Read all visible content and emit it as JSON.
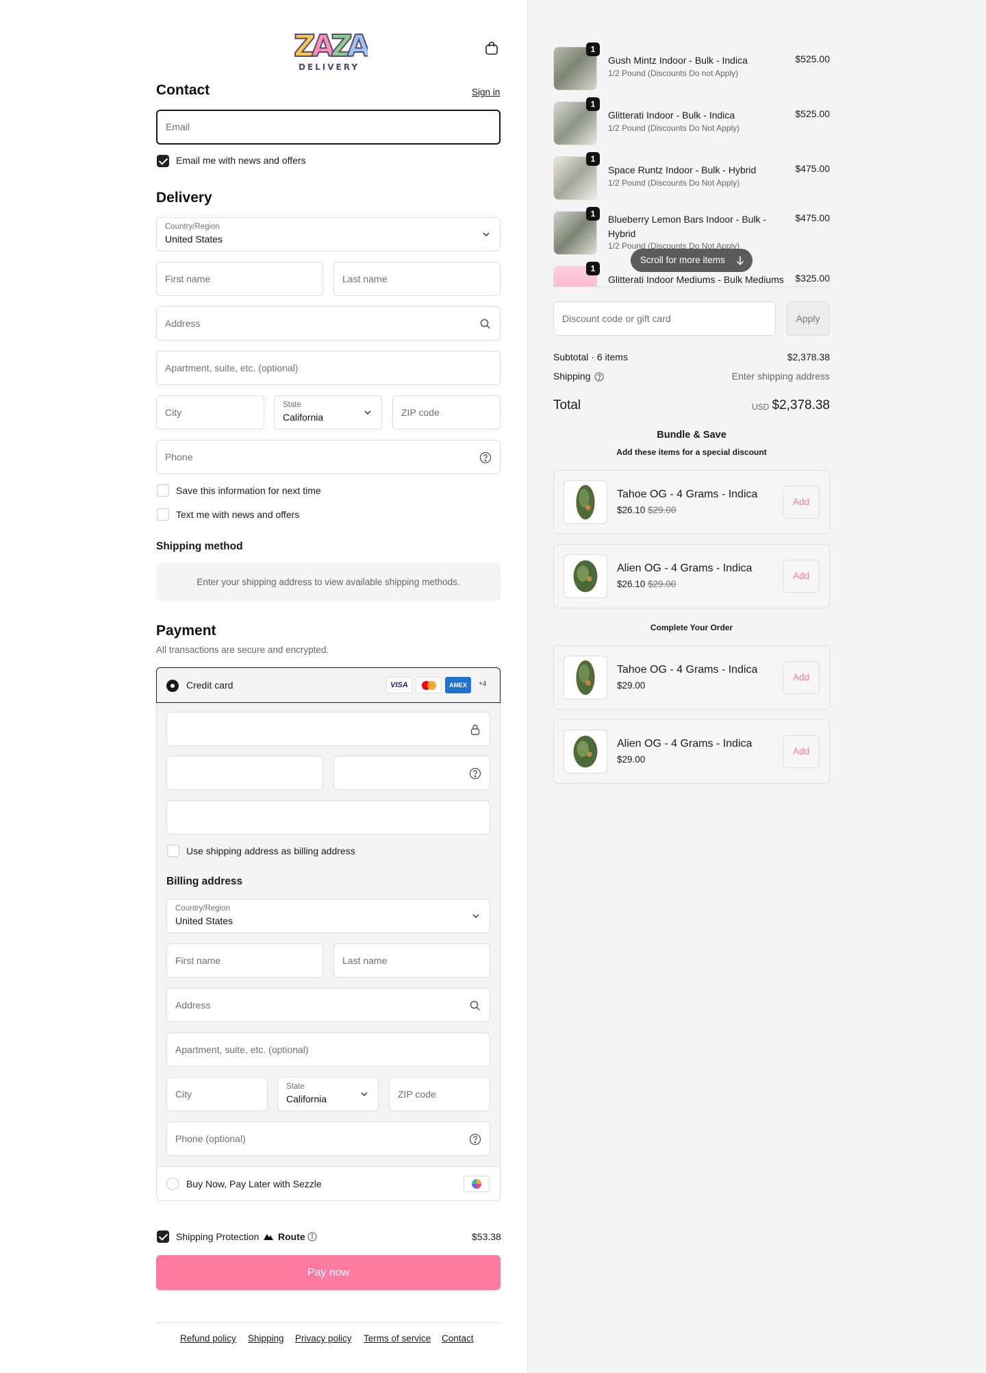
{
  "brand": {
    "logo_text": "ZAZA",
    "logo_sub": "DELIVERY"
  },
  "contact": {
    "title": "Contact",
    "sign_in": "Sign in",
    "email_placeholder": "Email",
    "news_label": "Email me with news and offers"
  },
  "delivery": {
    "title": "Delivery",
    "country_label": "Country/Region",
    "country_value": "United States",
    "first_name": "First name",
    "last_name": "Last name",
    "address": "Address",
    "apartment": "Apartment, suite, etc. (optional)",
    "city": "City",
    "state_label": "State",
    "state_value": "California",
    "zip": "ZIP code",
    "phone": "Phone",
    "save_info": "Save this information for next time",
    "text_me": "Text me with news and offers"
  },
  "shipping_method": {
    "title": "Shipping method",
    "notice": "Enter your shipping address to view available shipping methods."
  },
  "payment": {
    "title": "Payment",
    "subtitle": "All transactions are secure and encrypted.",
    "credit_card": "Credit card",
    "more_cards": "+4",
    "use_shipping": "Use shipping address as billing address",
    "billing_title": "Billing address",
    "billing": {
      "country_label": "Country/Region",
      "country_value": "United States",
      "first_name": "First name",
      "last_name": "Last name",
      "address": "Address",
      "apartment": "Apartment, suite, etc. (optional)",
      "city": "City",
      "state_label": "State",
      "state_value": "California",
      "zip": "ZIP code",
      "phone": "Phone (optional)"
    },
    "sezzle": "Buy Now, Pay Later with Sezzle",
    "card_brands": [
      "VISA",
      "mastercard",
      "AMEX"
    ]
  },
  "protection": {
    "label": "Shipping Protection",
    "brand": "Route",
    "price": "$53.38"
  },
  "pay_button": "Pay now",
  "footer": {
    "links": [
      "Refund policy",
      "Shipping",
      "Privacy policy",
      "Terms of service",
      "Contact"
    ]
  },
  "cart": {
    "items": [
      {
        "qty": "1",
        "name": "Gush Mintz Indoor - Bulk - Indica",
        "sub": "1/2 Pound (Discounts Do not Apply)",
        "price": "$525.00"
      },
      {
        "qty": "1",
        "name": "Glitterati Indoor - Bulk - Indica",
        "sub": "1/2 Pound (Discounts Do Not Apply)",
        "price": "$525.00"
      },
      {
        "qty": "1",
        "name": "Space Runtz Indoor - Bulk - Hybrid",
        "sub": "1/2 Pound (Discounts Do Not Apply)",
        "price": "$475.00"
      },
      {
        "qty": "1",
        "name": "Blueberry Lemon Bars Indoor - Bulk - Hybrid",
        "sub": "1/2 Pound (Discounts Do Not Apply)",
        "price": "$475.00"
      },
      {
        "qty": "1",
        "name": "Glitterati Indoor Mediums - Bulk Mediums - Indica",
        "sub": "",
        "price": "$325.00"
      }
    ],
    "scroll_hint": "Scroll for more items",
    "discount_placeholder": "Discount code or gift card",
    "apply": "Apply",
    "subtotal_label": "Subtotal · 6 items",
    "subtotal_value": "$2,378.38",
    "shipping_label": "Shipping",
    "shipping_value": "Enter shipping address",
    "total_label": "Total",
    "currency": "USD",
    "total_value": "$2,378.38"
  },
  "bundle": {
    "title": "Bundle & Save",
    "subtitle": "Add these items for a special discount",
    "items": [
      {
        "name": "Tahoe OG - 4 Grams - Indica",
        "price": "$26.10",
        "old_price": "$29.00",
        "add": "Add"
      },
      {
        "name": "Alien OG - 4 Grams - Indica",
        "price": "$26.10",
        "old_price": "$29.00",
        "add": "Add"
      }
    ]
  },
  "complete": {
    "title": "Complete Your Order",
    "items": [
      {
        "name": "Tahoe OG - 4 Grams - Indica",
        "price": "$29.00",
        "add": "Add"
      },
      {
        "name": "Alien OG - 4 Grams - Indica",
        "price": "$29.00",
        "add": "Add"
      }
    ]
  },
  "colors": {
    "accent": "#ff7aa0",
    "panel": "#f4f4f4"
  }
}
